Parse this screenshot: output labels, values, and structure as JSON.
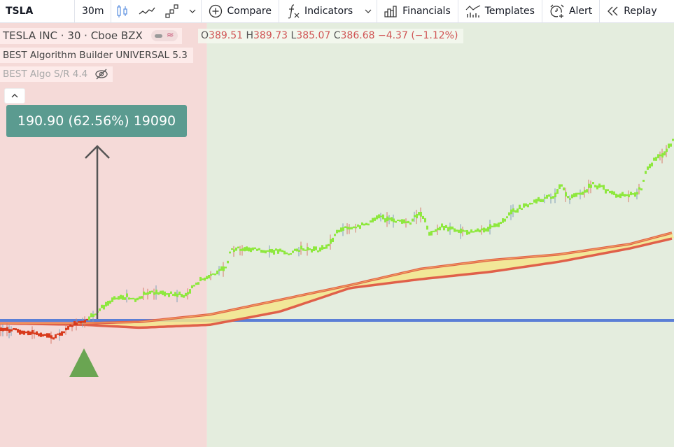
{
  "toolbar": {
    "symbol": "TSLA",
    "interval": "30m",
    "compare_label": "Compare",
    "indicators_label": "Indicators",
    "financials_label": "Financials",
    "templates_label": "Templates",
    "alert_label": "Alert",
    "replay_label": "Replay"
  },
  "legend": {
    "title": "TESLA INC · 30 · Cboe BZX",
    "ohlc": {
      "o_key": "O",
      "o": "389.51",
      "h_key": "H",
      "h": "389.73",
      "l_key": "L",
      "l": "385.07",
      "c_key": "C",
      "c": "386.68",
      "change": "−4.37 (−1.12%)"
    },
    "indicators": [
      {
        "label": "BEST Algorithm Builder UNIVERSAL 5.3",
        "visible": true
      },
      {
        "label": "BEST Algo S/R 4.4",
        "visible": false
      }
    ]
  },
  "measure_label": "190.90 (62.56%) 19090",
  "colors": {
    "bear_zone": "#f5dad8",
    "bull_zone": "#e4edde",
    "bull_candle": "#8ee83e",
    "bear_candle": "#d83a1c",
    "sr_line": "#5b7fd6",
    "ribbon_outer": "#e0604a",
    "ribbon_fill": "#f4e58c",
    "signal_triangle": "#6aa552",
    "measure_arrow": "#555555"
  },
  "chart_data": {
    "type": "candlestick-overlay",
    "symbol": "TSLA",
    "interval": "30m",
    "support_level_relative": 0.0,
    "price_path": [
      [
        0,
        -6
      ],
      [
        20,
        -7
      ],
      [
        40,
        -8
      ],
      [
        60,
        -10
      ],
      [
        75,
        -12
      ],
      [
        90,
        -8
      ],
      [
        105,
        -2
      ],
      [
        118,
        0
      ],
      [
        125,
        1
      ],
      [
        135,
        5
      ],
      [
        150,
        11
      ],
      [
        165,
        15
      ],
      [
        180,
        16
      ],
      [
        195,
        14
      ],
      [
        205,
        18
      ],
      [
        220,
        19
      ],
      [
        240,
        18
      ],
      [
        265,
        17
      ],
      [
        278,
        25
      ],
      [
        295,
        30
      ],
      [
        310,
        33
      ],
      [
        322,
        36
      ],
      [
        328,
        48
      ],
      [
        345,
        49
      ],
      [
        370,
        48
      ],
      [
        400,
        47
      ],
      [
        410,
        45
      ],
      [
        430,
        49
      ],
      [
        455,
        48
      ],
      [
        470,
        52
      ],
      [
        480,
        60
      ],
      [
        495,
        63
      ],
      [
        520,
        65
      ],
      [
        540,
        70
      ],
      [
        560,
        68
      ],
      [
        585,
        67
      ],
      [
        598,
        74
      ],
      [
        608,
        66
      ],
      [
        612,
        58
      ],
      [
        630,
        64
      ],
      [
        660,
        60
      ],
      [
        680,
        61
      ],
      [
        700,
        63
      ],
      [
        715,
        67
      ],
      [
        730,
        74
      ],
      [
        750,
        78
      ],
      [
        770,
        82
      ],
      [
        790,
        85
      ],
      [
        800,
        92
      ],
      [
        810,
        83
      ],
      [
        830,
        86
      ],
      [
        845,
        93
      ],
      [
        860,
        90
      ],
      [
        875,
        86
      ],
      [
        890,
        85
      ],
      [
        905,
        86
      ],
      [
        915,
        90
      ],
      [
        920,
        100
      ],
      [
        935,
        110
      ],
      [
        950,
        115
      ],
      [
        963,
        125
      ]
    ],
    "ribbon": {
      "upper": [
        [
          0,
          -2
        ],
        [
          120,
          -2
        ],
        [
          200,
          -1
        ],
        [
          300,
          4
        ],
        [
          400,
          14
        ],
        [
          500,
          24
        ],
        [
          600,
          35
        ],
        [
          700,
          41
        ],
        [
          800,
          45
        ],
        [
          900,
          52
        ],
        [
          963,
          60
        ]
      ],
      "lower": [
        [
          0,
          -2
        ],
        [
          120,
          -3
        ],
        [
          200,
          -5
        ],
        [
          300,
          -3
        ],
        [
          400,
          6
        ],
        [
          500,
          22
        ],
        [
          600,
          28
        ],
        [
          700,
          33
        ],
        [
          800,
          40
        ],
        [
          900,
          49
        ],
        [
          963,
          56
        ]
      ]
    },
    "signal": {
      "type": "buy",
      "at_x_index": 125
    },
    "zones": [
      {
        "type": "bearish",
        "end_fraction": 0.307
      },
      {
        "type": "bullish",
        "end_fraction": 1.0
      }
    ]
  }
}
